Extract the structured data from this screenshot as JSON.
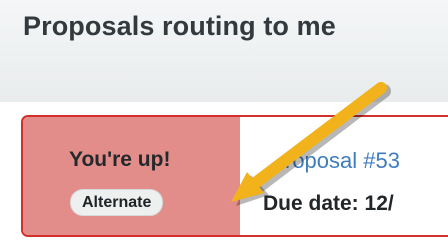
{
  "section": {
    "title": "Proposals routing to me"
  },
  "card": {
    "status_text": "You're up!",
    "role_badge": "Alternate",
    "proposal_link": "roposal #53",
    "due_label": "Due date:",
    "due_value": "12/"
  },
  "annotation": {
    "arrow_color": "#f2b21c",
    "arrow_icon": "callout-arrow-icon"
  },
  "colors": {
    "card_border": "#d2302a",
    "card_highlight": "#e28d89",
    "link": "#3f7dbd"
  }
}
